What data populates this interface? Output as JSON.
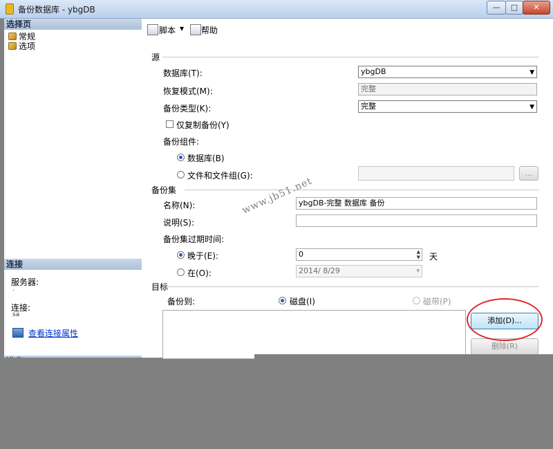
{
  "window": {
    "title": "备份数据库 - ybgDB",
    "minimize_glyph": "—",
    "maximize_glyph": "□",
    "close_glyph": "✕"
  },
  "left": {
    "select_page_header": "选择页",
    "pages": [
      "常规",
      "选项"
    ],
    "connection_header": "连接",
    "server_label": "服务器:",
    "server_value": ".",
    "connection_label": "连接:",
    "connection_value": "sa",
    "view_connection_link": "查看连接属性",
    "progress_header": "进度"
  },
  "toolbar": {
    "script_label": "脚本",
    "script_dropdown_glyph": "▾",
    "help_label": "帮助"
  },
  "source": {
    "group_label": "源",
    "database_label": "数据库(T):",
    "database_value": "ybgDB",
    "recovery_label": "恢复模式(M):",
    "recovery_value": "完整",
    "backup_type_label": "备份类型(K):",
    "backup_type_value": "完整",
    "copy_only_label": "仅复制备份(Y)",
    "component_label": "备份组件:",
    "component_db_label": "数据库(B)",
    "component_files_label": "文件和文件组(G):",
    "browse_label": "..."
  },
  "backup_set": {
    "group_label": "备份集",
    "name_label": "名称(N):",
    "name_value": "ybgDB-完整 数据库 备份",
    "desc_label": "说明(S):",
    "desc_value": "",
    "expire_label": "备份集过期时间:",
    "after_label": "晚于(E):",
    "after_value": "0",
    "days_label": "天",
    "on_label": "在(O):",
    "on_value": "2014/ 8/29"
  },
  "destination": {
    "group_label": "目标",
    "backup_to_label": "备份到:",
    "disk_label": "磁盘(I)",
    "tape_label": "磁带(P)",
    "add_label": "添加(D)...",
    "remove_label": "删除(R)"
  },
  "watermark": "www.jb51.net",
  "colors": {
    "highlight": "#e0262a",
    "link": "#0033cc"
  }
}
